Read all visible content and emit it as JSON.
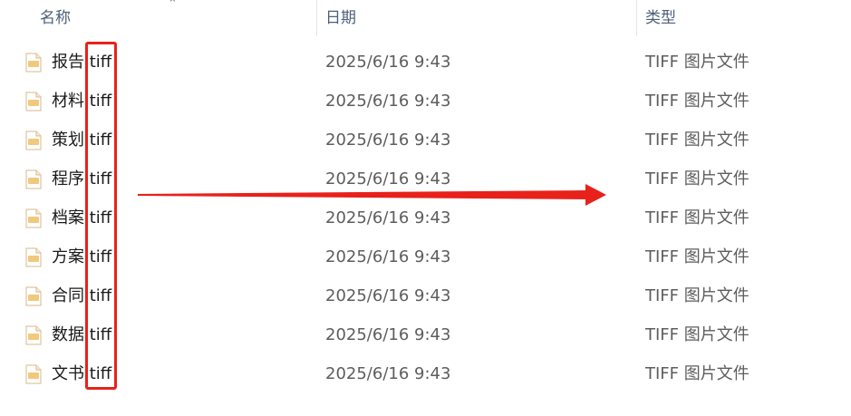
{
  "header": {
    "name_label": "名称",
    "date_label": "日期",
    "type_label": "类型",
    "sort_icon": "chevron-up-icon"
  },
  "files": [
    {
      "name": "报告.tiff",
      "date": "2025/6/16 9:43",
      "type": "TIFF 图片文件"
    },
    {
      "name": "材料.tiff",
      "date": "2025/6/16 9:43",
      "type": "TIFF 图片文件"
    },
    {
      "name": "策划.tiff",
      "date": "2025/6/16 9:43",
      "type": "TIFF 图片文件"
    },
    {
      "name": "程序.tiff",
      "date": "2025/6/16 9:43",
      "type": "TIFF 图片文件"
    },
    {
      "name": "档案.tiff",
      "date": "2025/6/16 9:43",
      "type": "TIFF 图片文件"
    },
    {
      "name": "方案.tiff",
      "date": "2025/6/16 9:43",
      "type": "TIFF 图片文件"
    },
    {
      "name": "合同.tiff",
      "date": "2025/6/16 9:43",
      "type": "TIFF 图片文件"
    },
    {
      "name": "数据.tiff",
      "date": "2025/6/16 9:43",
      "type": "TIFF 图片文件"
    },
    {
      "name": "文书.tiff",
      "date": "2025/6/16 9:43",
      "type": "TIFF 图片文件"
    }
  ],
  "annotation": {
    "box_color": "#e8211b",
    "arrow_color": "#e8211b"
  },
  "icons": {
    "file_icon": "tiff-file-icon"
  }
}
